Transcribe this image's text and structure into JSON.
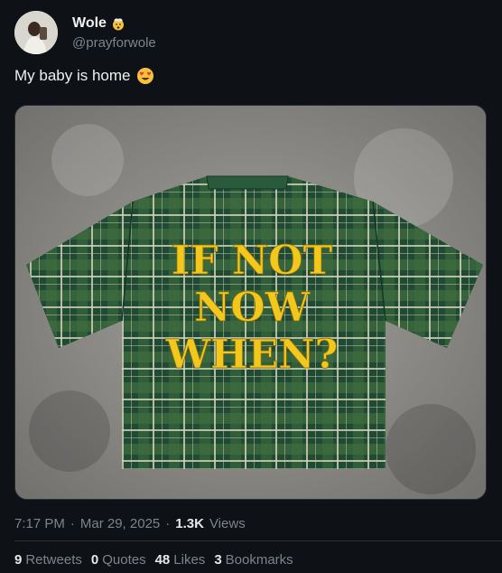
{
  "author": {
    "display_name": "Wole",
    "handle": "@prayforwole",
    "badge_icon": "mind-blown-emoji-icon"
  },
  "post": {
    "text": "My baby is home",
    "emoji": "heart-eyes-emoji-icon"
  },
  "photo": {
    "shirt_text": [
      "IF NOT",
      "NOW",
      "WHEN?"
    ],
    "colors": {
      "plaid_dark": "#1f4a35",
      "plaid_mid": "#3d6a3e",
      "text_yellow": "#f2c81c",
      "concrete": "#8d8c89"
    }
  },
  "meta": {
    "time": "7:17 PM",
    "separator": "·",
    "date": "Mar 29, 2025",
    "separator2": "·",
    "views_count": "1.3K",
    "views_label": "Views"
  },
  "stats": [
    {
      "num": "9",
      "label": "Retweets"
    },
    {
      "num": "0",
      "label": "Quotes"
    },
    {
      "num": "48",
      "label": "Likes"
    },
    {
      "num": "3",
      "label": "Bookmarks"
    }
  ]
}
